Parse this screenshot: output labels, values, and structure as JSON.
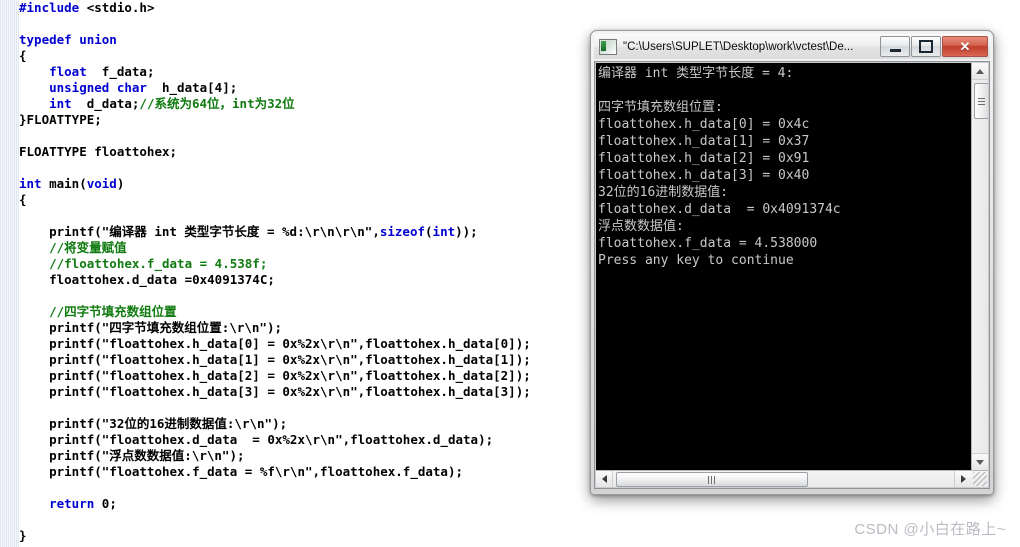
{
  "editor": {
    "name": "source-code-editor",
    "language": "c",
    "code_lines": [
      [
        {
          "t": "#include ",
          "c": "kw"
        },
        {
          "t": "<stdio.h>",
          "c": "tx"
        }
      ],
      [],
      [
        {
          "t": "typedef union",
          "c": "kw"
        }
      ],
      [
        {
          "t": "{",
          "c": "tx"
        }
      ],
      [
        {
          "t": "    ",
          "c": "tx"
        },
        {
          "t": "float",
          "c": "kw"
        },
        {
          "t": "  f_data;",
          "c": "tx"
        }
      ],
      [
        {
          "t": "    ",
          "c": "tx"
        },
        {
          "t": "unsigned char",
          "c": "kw"
        },
        {
          "t": "  h_data[4];",
          "c": "tx"
        }
      ],
      [
        {
          "t": "    ",
          "c": "tx"
        },
        {
          "t": "int",
          "c": "kw"
        },
        {
          "t": "  d_data;",
          "c": "tx"
        },
        {
          "t": "//系统为64位，int为32位",
          "c": "cm"
        }
      ],
      [
        {
          "t": "}FLOATTYPE;",
          "c": "tx"
        }
      ],
      [],
      [
        {
          "t": "FLOATTYPE floattohex;",
          "c": "tx"
        }
      ],
      [],
      [
        {
          "t": "int",
          "c": "kw"
        },
        {
          "t": " main(",
          "c": "tx"
        },
        {
          "t": "void",
          "c": "kw"
        },
        {
          "t": ")",
          "c": "tx"
        }
      ],
      [
        {
          "t": "{",
          "c": "tx"
        }
      ],
      [],
      [
        {
          "t": "    printf(\"编译器 int 类型字节长度 = %d:\\r\\n\\r\\n\",",
          "c": "tx"
        },
        {
          "t": "sizeof",
          "c": "kw"
        },
        {
          "t": "(",
          "c": "tx"
        },
        {
          "t": "int",
          "c": "kw"
        },
        {
          "t": "));",
          "c": "tx"
        }
      ],
      [
        {
          "t": "    //将变量赋值",
          "c": "cm"
        }
      ],
      [
        {
          "t": "    //floattohex.f_data = 4.538f;",
          "c": "cm"
        }
      ],
      [
        {
          "t": "    floattohex.d_data =0x4091374C;",
          "c": "tx"
        }
      ],
      [],
      [
        {
          "t": "    //四字节填充数组位置",
          "c": "cm"
        }
      ],
      [
        {
          "t": "    printf(\"四字节填充数组位置:\\r\\n\");",
          "c": "tx"
        }
      ],
      [
        {
          "t": "    printf(\"floattohex.h_data[0] = 0x%2x\\r\\n\",floattohex.h_data[0]);",
          "c": "tx"
        }
      ],
      [
        {
          "t": "    printf(\"floattohex.h_data[1] = 0x%2x\\r\\n\",floattohex.h_data[1]);",
          "c": "tx"
        }
      ],
      [
        {
          "t": "    printf(\"floattohex.h_data[2] = 0x%2x\\r\\n\",floattohex.h_data[2]);",
          "c": "tx"
        }
      ],
      [
        {
          "t": "    printf(\"floattohex.h_data[3] = 0x%2x\\r\\n\",floattohex.h_data[3]);",
          "c": "tx"
        }
      ],
      [],
      [
        {
          "t": "    printf(\"32位的16进制数据值:\\r\\n\");",
          "c": "tx"
        }
      ],
      [
        {
          "t": "    printf(\"floattohex.d_data  = 0x%2x\\r\\n\",floattohex.d_data);",
          "c": "tx"
        }
      ],
      [
        {
          "t": "    printf(\"浮点数数据值:\\r\\n\");",
          "c": "tx"
        }
      ],
      [
        {
          "t": "    printf(\"floattohex.f_data = %f\\r\\n\",floattohex.f_data);",
          "c": "tx"
        }
      ],
      [],
      [
        {
          "t": "    ",
          "c": "tx"
        },
        {
          "t": "return",
          "c": "kw"
        },
        {
          "t": " 0;",
          "c": "tx"
        }
      ],
      [],
      [
        {
          "t": "}",
          "c": "tx"
        }
      ]
    ],
    "syntax_colors": {
      "keyword": "#0000d0",
      "comment": "#107b10",
      "text": "#000000",
      "background": "#ffffff",
      "gutter": "#edf0f7"
    }
  },
  "console_window": {
    "title": "\"C:\\Users\\SUPLET\\Desktop\\work\\vctest\\De...",
    "icon": "console-icon",
    "buttons": {
      "minimize_label": "",
      "maximize_label": "",
      "close_label": "✕"
    },
    "output_lines": [
      "编译器 int 类型字节长度 = 4:",
      "",
      "四字节填充数组位置:",
      "floattohex.h_data[0] = 0x4c",
      "floattohex.h_data[1] = 0x37",
      "floattohex.h_data[2] = 0x91",
      "floattohex.h_data[3] = 0x40",
      "32位的16进制数据值:",
      "floattohex.d_data  = 0x4091374c",
      "浮点数数据值:",
      "floattohex.f_data = 4.538000",
      "Press any key to continue"
    ],
    "colors": {
      "background": "#000000",
      "foreground": "#c8c8c8",
      "close_button": "#bf3d2b"
    }
  },
  "watermark": {
    "text": "CSDN @小白在路上~"
  }
}
